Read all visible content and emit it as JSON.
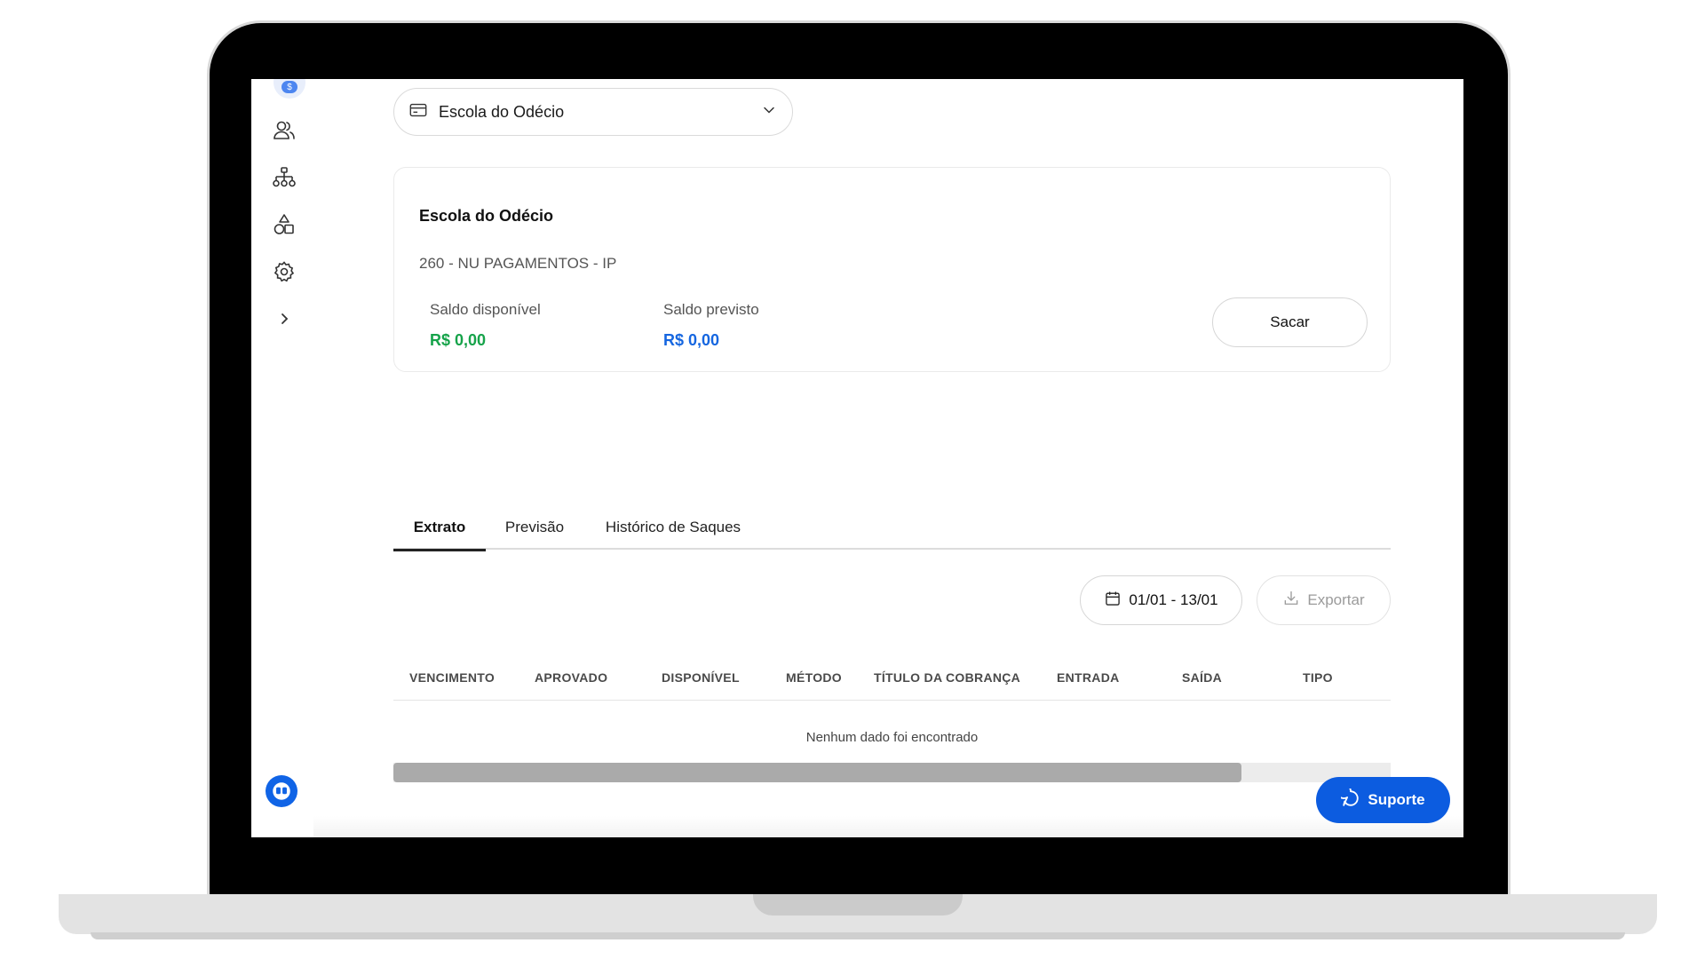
{
  "icons": {
    "avatar": "dollar-avatar-icon",
    "people": "users-icon",
    "hierarchy": "org-chart-icon",
    "shapes": "shapes-icon",
    "settings": "gear-icon",
    "expand": "chevron-right-icon",
    "chat": "chat-icon",
    "card": "card-icon",
    "dropdown": "chevron-down-icon",
    "calendar": "calendar-icon",
    "download": "download-icon",
    "support": "message-circle-icon"
  },
  "sidebar": {
    "avatar_symbol": "$"
  },
  "account_selector": {
    "value": "Escola do Odécio"
  },
  "balance_card": {
    "title": "Escola do Odécio",
    "bank": "260 - NU PAGAMENTOS - IP",
    "available_label": "Saldo disponível",
    "available_value": "R$ 0,00",
    "forecast_label": "Saldo previsto",
    "forecast_value": "R$ 0,00",
    "withdraw_label": "Sacar"
  },
  "tabs": [
    {
      "label": "Extrato",
      "active": true
    },
    {
      "label": "Previsão",
      "active": false
    },
    {
      "label": "Histórico de Saques",
      "active": false
    }
  ],
  "filters": {
    "date_range": "01/01 - 13/01",
    "export_label": "Exportar"
  },
  "table": {
    "columns": [
      "VENCIMENTO",
      "APROVADO",
      "DISPONÍVEL",
      "MÉTODO",
      "TÍTULO DA COBRANÇA",
      "ENTRADA",
      "SAÍDA",
      "TIPO"
    ],
    "empty_message": "Nenhum dado foi encontrado",
    "horizontal_scroll_fraction": 0.85
  },
  "support": {
    "label": "Suporte"
  },
  "colors": {
    "positive": "#16a34a",
    "forecast": "#1566e0",
    "accent": "#0c5ce0"
  }
}
